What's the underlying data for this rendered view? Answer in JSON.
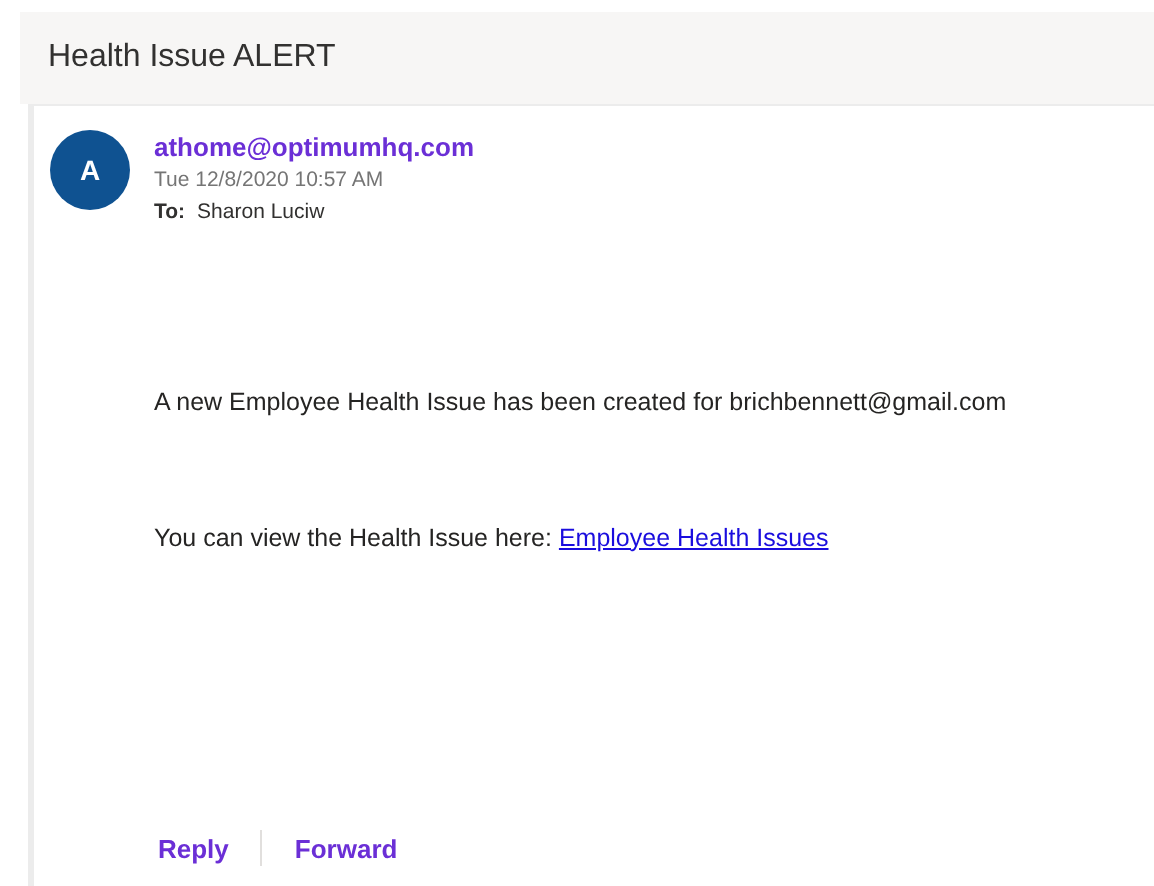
{
  "subject": "Health Issue ALERT",
  "message": {
    "avatar_initial": "A",
    "sender": "athome@optimumhq.com",
    "date": "Tue 12/8/2020 10:57 AM",
    "to_label": "To:",
    "to": "Sharon Luciw",
    "body": [
      {
        "text": "A new Employee Health Issue has been created for brichbennett@gmail.com"
      },
      {
        "text": "You can view the Health Issue here:",
        "link": "Employee Health Issues"
      }
    ]
  },
  "actions": [
    "Reply",
    "Forward"
  ]
}
